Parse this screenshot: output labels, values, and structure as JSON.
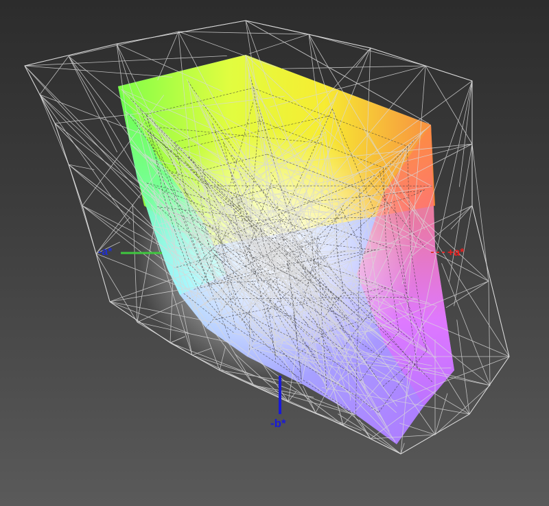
{
  "axes": {
    "neg_a": {
      "label": "-a*",
      "color": "#1f2fd0",
      "line_color": "#3fc83f"
    },
    "pos_a": {
      "label": "+a*",
      "color": "#e82020",
      "line_color": "#e03030"
    },
    "neg_b": {
      "label": "-b*",
      "color": "#1a1ad8",
      "line_color": "#1a1ad8"
    }
  },
  "colors": {
    "background_top": "#2c2c2c",
    "background_bottom": "#5a5a5a",
    "wireframe": "#d8d8d8",
    "yellow": "#ffff00",
    "green": "#66ff44",
    "cyan": "#66ffff",
    "blue": "#66aaff",
    "violet": "#aa66ff",
    "magenta": "#ff55ff",
    "red": "#ff4466",
    "orange": "#ff8833",
    "white_point": "#ffffff"
  }
}
